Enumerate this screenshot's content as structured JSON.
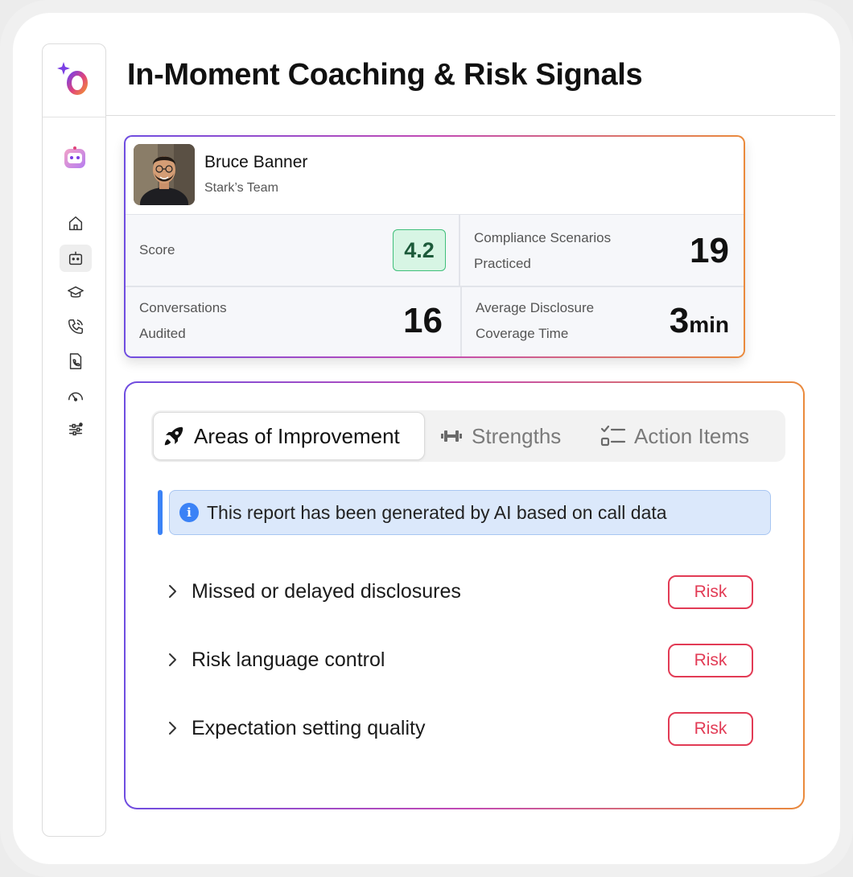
{
  "page": {
    "title": "In-Moment Coaching & Risk Signals"
  },
  "sidebar": {
    "items": [
      {
        "icon": "home-icon"
      },
      {
        "icon": "bot-icon",
        "active": true
      },
      {
        "icon": "graduation-cap-icon"
      },
      {
        "icon": "phone-call-icon"
      },
      {
        "icon": "phone-file-icon"
      },
      {
        "icon": "gauge-icon"
      },
      {
        "icon": "sliders-icon"
      }
    ]
  },
  "profile": {
    "name": "Bruce Banner",
    "team": "Stark’s Team",
    "stats": {
      "score": {
        "label": "Score",
        "value": "4.2"
      },
      "compliance": {
        "label_line1": "Compliance Scenarios",
        "label_line2": "Practiced",
        "value": "19"
      },
      "conversations": {
        "label_line1": "Conversations",
        "label_line2": "Audited",
        "value": "16"
      },
      "coverage": {
        "label_line1": "Average Disclosure",
        "label_line2": "Coverage Time",
        "value": "3",
        "unit": "min"
      }
    }
  },
  "tabs": [
    {
      "label": "Areas of Improvement",
      "icon": "rocket-icon",
      "active": true
    },
    {
      "label": "Strengths",
      "icon": "dumbbell-icon"
    },
    {
      "label": "Action Items",
      "icon": "checklist-icon"
    }
  ],
  "info_banner": {
    "text": "This report has been generated by AI based on call data"
  },
  "improvements": [
    {
      "title": "Missed or delayed disclosures",
      "badge": "Risk"
    },
    {
      "title": "Risk language control",
      "badge": "Risk"
    },
    {
      "title": "Expectation setting quality",
      "badge": "Risk"
    }
  ],
  "colors": {
    "risk": "#e23b55",
    "score_bg": "#d7f5e4",
    "info_bg": "#dbe8fb",
    "accent_blue": "#3b82f6"
  }
}
